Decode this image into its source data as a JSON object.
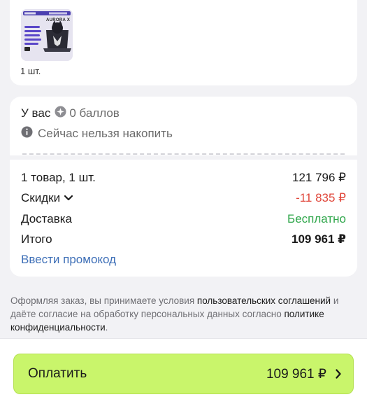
{
  "product": {
    "thumbnail_icon": "laptop-product-image",
    "thumbnail_title": "AURORA X",
    "quantity": "1 шт."
  },
  "points": {
    "prefix": "У вас",
    "icon": "points-coin-icon",
    "balance": "0 баллов",
    "info_icon": "info-icon",
    "info_text": "Сейчас нельзя накопить"
  },
  "summary": {
    "items_label": "1 товар, 1 шт.",
    "items_value": "121 796 ₽",
    "discount_label": "Скидки",
    "discount_value": "-11 835 ₽",
    "delivery_label": "Доставка",
    "delivery_value": "Бесплатно",
    "total_label": "Итого",
    "total_value": "109 961 ₽",
    "promo_link": "Ввести промокод"
  },
  "legal": {
    "text_1": "Оформляя заказ, вы принимаете условия ",
    "link_1": "пользовательских соглашений",
    "text_2": " и даёте согласие на обработку персональных данных согласно ",
    "link_2": "политике конфиденциальности",
    "text_3": "."
  },
  "pay_button": {
    "label": "Оплатить",
    "amount": "109 961 ₽",
    "icon": "chevron-right-icon"
  },
  "colors": {
    "accent_button": "#c9f56b",
    "discount": "#e0463a",
    "free_delivery": "#2ea64a",
    "link": "#3e6fb7"
  }
}
